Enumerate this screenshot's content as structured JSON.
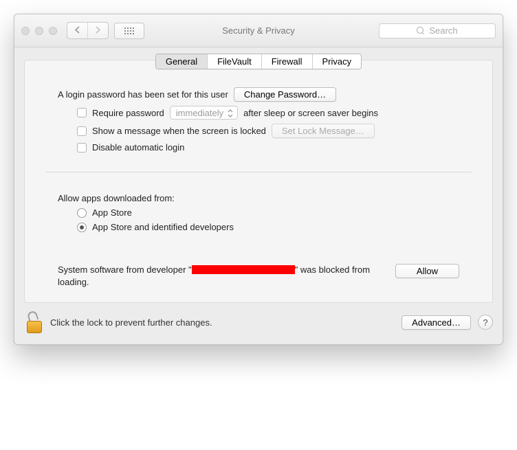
{
  "window": {
    "title": "Security & Privacy"
  },
  "toolbar": {
    "search_placeholder": "Search"
  },
  "tabs": {
    "general": "General",
    "filevault": "FileVault",
    "firewall": "Firewall",
    "privacy": "Privacy"
  },
  "login": {
    "set_text": "A login password has been set for this user",
    "change_btn": "Change Password…",
    "require_label": "Require password",
    "require_after": "after sleep or screen saver begins",
    "delay_select": "immediately",
    "show_msg_label": "Show a message when the screen is locked",
    "set_lock_btn": "Set Lock Message…",
    "disable_auto": "Disable automatic login"
  },
  "allow": {
    "heading": "Allow apps downloaded from:",
    "opt_store": "App Store",
    "opt_dev": "App Store and identified developers"
  },
  "blocked": {
    "pre": "System software from developer \"",
    "post": "\" was blocked from loading.",
    "allow_btn": "Allow"
  },
  "footer": {
    "lock_text": "Click the lock to prevent further changes.",
    "advanced_btn": "Advanced…",
    "help": "?"
  }
}
